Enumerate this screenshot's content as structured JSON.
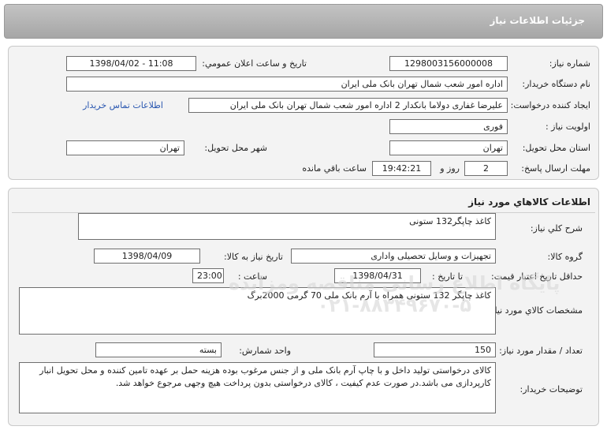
{
  "header": {
    "title": "جزئيات اطلاعات نياز"
  },
  "info": {
    "need_number_label": "شماره نياز:",
    "need_number": "1298003156000008",
    "announce_label": "تاريخ و ساعت اعلان عمومي:",
    "announce_value": "1398/04/02 - 11:08",
    "buyer_label": "نام دستگاه خريدار:",
    "buyer_value": "اداره امور شعب شمال تهران بانک ملی ایران",
    "creator_label": "ايجاد کننده درخواست:",
    "creator_value": "علیرضا  غفاری دولاما بانکدار 2 اداره امور شعب شمال تهران بانک ملی ایران",
    "contact_link": "اطلاعات تماس خريدار",
    "priority_label": "اولويت نياز :",
    "priority_value": "فوری",
    "province_label": "استان محل تحويل:",
    "province_value": "تهران",
    "city_label": "شهر محل تحويل:",
    "city_value": "تهران",
    "deadline_label": "مهلت ارسال پاسخ:",
    "deadline_days": "2",
    "days_label": "روز و",
    "deadline_time": "19:42:21",
    "remaining_label": "ساعت باقي مانده"
  },
  "goods": {
    "section_title": "اطلاعات كالاهاي مورد نياز",
    "desc_label": "شرح كلي نياز:",
    "desc_value": "کاغذ چاپگر132 ستونی",
    "group_label": "گروه كالا:",
    "group_value": "تجهیزات و وسایل تحصیلی واداری",
    "need_date_label": "تاريخ نياز به كالا:",
    "need_date_value": "1398/04/09",
    "validity_label": "حداقل تاريخ اعتبار قيمت:",
    "until_date_label": "تا تاريخ :",
    "until_date_value": "1398/04/31",
    "time_label": "ساعت :",
    "time_value": "23:00",
    "spec_label": "مشخصات كالاي مورد نياز:",
    "spec_value": "کاغذ چاپگر 132 ستونی همراه با آرم بانک ملی 70 گرمی 2000برگ",
    "qty_label": "تعداد / مقدار مورد نياز:",
    "qty_value": "150",
    "unit_label": "واحد شمارش:",
    "unit_value": "بسته",
    "notes_label": "توضيحات خريدار:",
    "notes_value": "کالای درخواستی تولید داخل و با چاپ آرم بانک ملی و از جنس مرغوب بوده هزینه حمل بر عهده تامین کننده و محل تحویل انبار کارپردازی می باشد.در صورت عدم کیفیت ، کالای درخواستی بدون پرداخت هیچ وجهی مرجوع خواهد شد."
  },
  "watermark": {
    "line1": "پایگاه اطلاع رسانی مناقصه ومزایده",
    "line2": "۰۲۱-۸۸۳۴۹۶۷۰-۵"
  }
}
